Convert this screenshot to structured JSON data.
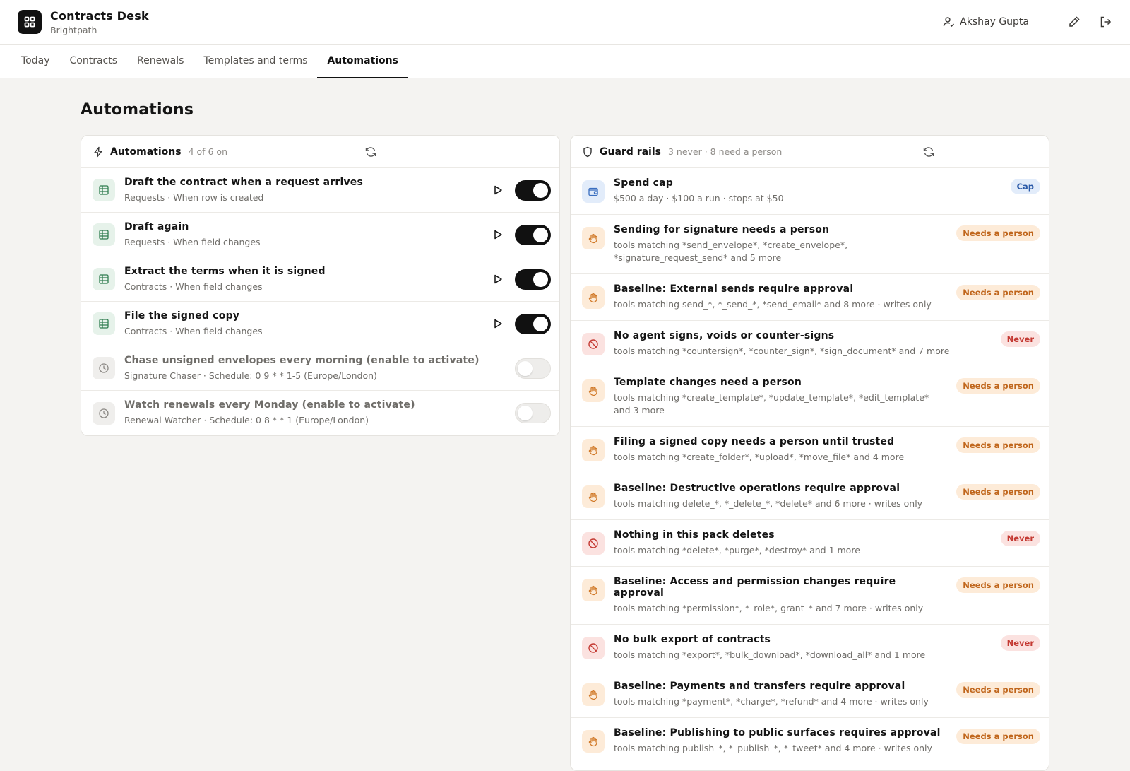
{
  "app": {
    "title": "Contracts Desk",
    "org": "Brightpath"
  },
  "user": {
    "name": "Akshay Gupta"
  },
  "tabs": [
    {
      "label": "Today"
    },
    {
      "label": "Contracts"
    },
    {
      "label": "Renewals"
    },
    {
      "label": "Templates and terms"
    },
    {
      "label": "Automations"
    }
  ],
  "page": {
    "title": "Automations"
  },
  "automations": {
    "title": "Automations",
    "meta": "4 of 6 on",
    "items": [
      {
        "title": "Draft the contract when a request arrives",
        "sub": "Requests · When row is created",
        "enabled": true
      },
      {
        "title": "Draft again",
        "sub": "Requests · When field changes",
        "enabled": true
      },
      {
        "title": "Extract the terms when it is signed",
        "sub": "Contracts · When field changes",
        "enabled": true
      },
      {
        "title": "File the signed copy",
        "sub": "Contracts · When field changes",
        "enabled": true
      },
      {
        "title": "Chase unsigned envelopes every morning (enable to activate)",
        "sub": "Signature Chaser · Schedule: 0 9 * * 1-5 (Europe/London)",
        "enabled": false
      },
      {
        "title": "Watch renewals every Monday (enable to activate)",
        "sub": "Renewal Watcher · Schedule: 0 8 * * 1 (Europe/London)",
        "enabled": false
      }
    ]
  },
  "guardrails": {
    "title": "Guard rails",
    "meta": "3 never · 8 need a person",
    "items": [
      {
        "title": "Spend cap",
        "sub": "$500 a day · $100 a run · stops at $50",
        "badge": "Cap",
        "kind": "cap",
        "icon": "wallet-icon"
      },
      {
        "title": "Sending for signature needs a person",
        "sub": "tools matching *send_envelope*, *create_envelope*, *signature_request_send* and 5 more",
        "badge": "Needs a person",
        "kind": "need",
        "icon": "hand-icon"
      },
      {
        "title": "Baseline: External sends require approval",
        "sub": "tools matching send_*, *_send_*, *send_email* and 8 more · writes only",
        "badge": "Needs a person",
        "kind": "need",
        "icon": "hand-icon"
      },
      {
        "title": "No agent signs, voids or counter-signs",
        "sub": "tools matching *countersign*, *counter_sign*, *sign_document* and 7 more",
        "badge": "Never",
        "kind": "never",
        "icon": "ban-icon"
      },
      {
        "title": "Template changes need a person",
        "sub": "tools matching *create_template*, *update_template*, *edit_template* and 3 more",
        "badge": "Needs a person",
        "kind": "need",
        "icon": "hand-icon"
      },
      {
        "title": "Filing a signed copy needs a person until trusted",
        "sub": "tools matching *create_folder*, *upload*, *move_file* and 4 more",
        "badge": "Needs a person",
        "kind": "need",
        "icon": "hand-icon"
      },
      {
        "title": "Baseline: Destructive operations require approval",
        "sub": "tools matching delete_*, *_delete_*, *delete* and 6 more · writes only",
        "badge": "Needs a person",
        "kind": "need",
        "icon": "hand-icon"
      },
      {
        "title": "Nothing in this pack deletes",
        "sub": "tools matching *delete*, *purge*, *destroy* and 1 more",
        "badge": "Never",
        "kind": "never",
        "icon": "ban-icon"
      },
      {
        "title": "Baseline: Access and permission changes require approval",
        "sub": "tools matching *permission*, *_role*, grant_* and 7 more · writes only",
        "badge": "Needs a person",
        "kind": "need",
        "icon": "hand-icon"
      },
      {
        "title": "No bulk export of contracts",
        "sub": "tools matching *export*, *bulk_download*, *download_all* and 1 more",
        "badge": "Never",
        "kind": "never",
        "icon": "ban-icon"
      },
      {
        "title": "Baseline: Payments and transfers require approval",
        "sub": "tools matching *payment*, *charge*, *refund* and 4 more · writes only",
        "badge": "Needs a person",
        "kind": "need",
        "icon": "hand-icon"
      },
      {
        "title": "Baseline: Publishing to public surfaces requires approval",
        "sub": "tools matching publish_*, *_publish_*, *_tweet* and 4 more · writes only",
        "badge": "Needs a person",
        "kind": "need",
        "icon": "hand-icon"
      }
    ]
  }
}
